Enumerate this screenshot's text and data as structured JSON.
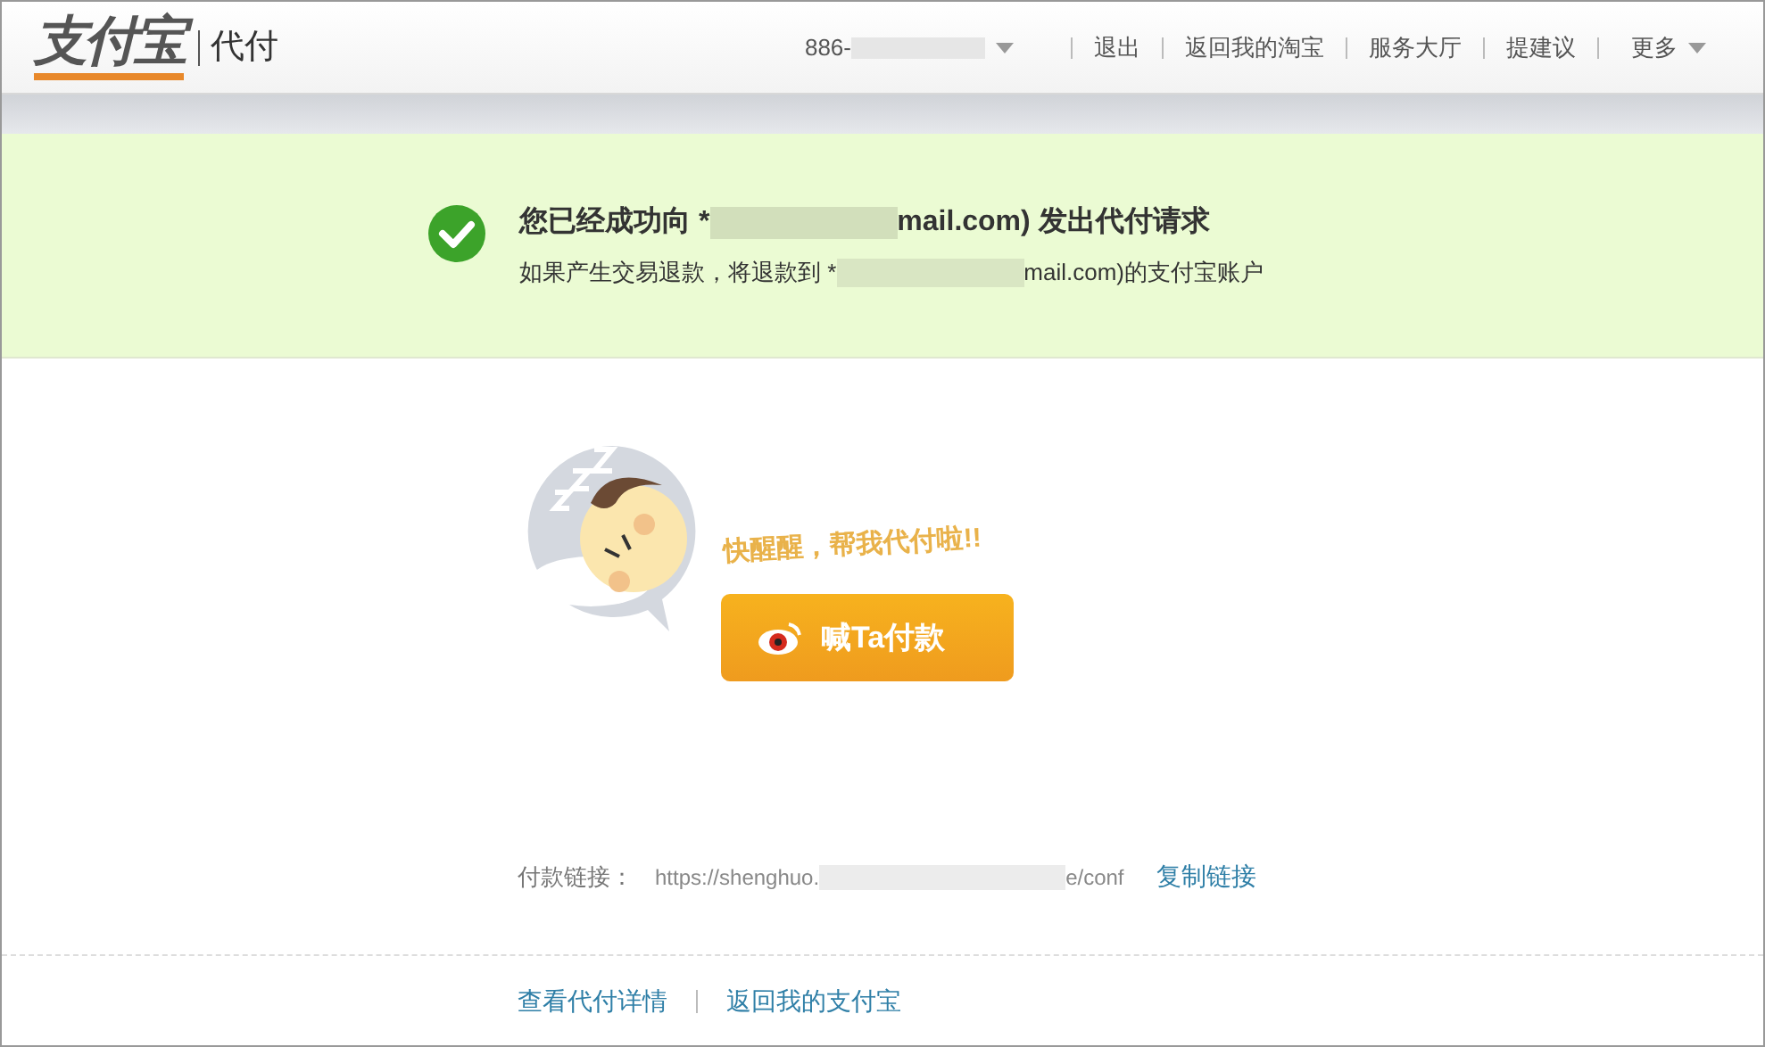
{
  "header": {
    "logo": "支付宝",
    "product": "代付",
    "account": {
      "prefix": "886-"
    },
    "nav": [
      {
        "label": "退出"
      },
      {
        "label": "返回我的淘宝"
      },
      {
        "label": "服务大厅"
      },
      {
        "label": "提建议"
      }
    ],
    "more": "更多"
  },
  "notice": {
    "title_start": "您已经成功向 *",
    "title_end": "mail.com) 发出代付请求",
    "sub_start": "如果产生交易退款，将退款到 *",
    "sub_end": "mail.com)的支付宝账户"
  },
  "promo": {
    "bubble": "快醒醒，帮我代付啦!!",
    "button": "喊Ta付款"
  },
  "link_row": {
    "label": "付款链接：",
    "url_start": "https://shenghuo.",
    "url_end": "e/conf",
    "copy": "复制链接"
  },
  "footer": [
    {
      "label": "查看代付详情"
    },
    {
      "label": "返回我的支付宝"
    }
  ]
}
